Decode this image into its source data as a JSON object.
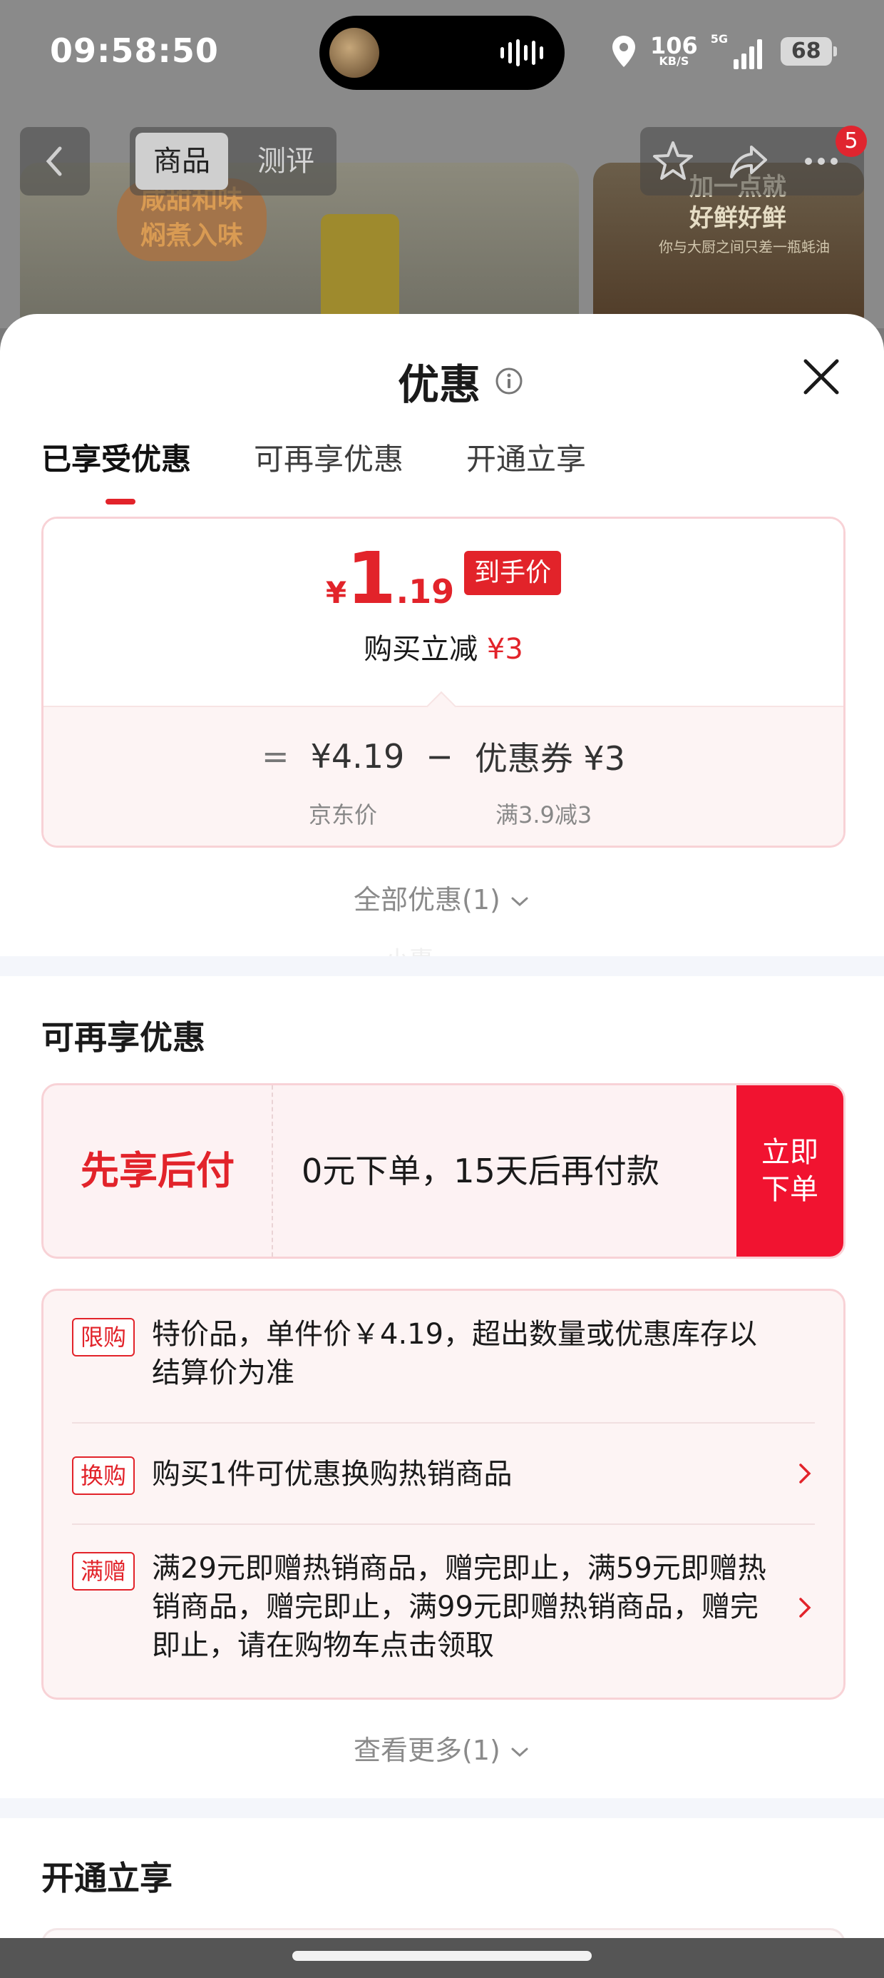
{
  "status_bar": {
    "time": "09:58:50",
    "net_speed": "106",
    "net_unit": "KB/S",
    "network": "5G",
    "battery": "68"
  },
  "background": {
    "tab_product": "商品",
    "tab_review": "测评",
    "cart_badge": "5",
    "banner_left": "咸甜和味\n焖煮入味",
    "banner_right": "加一点就\n好鲜好鲜",
    "banner_right_sub": "你与大厨之间只差一瓶蚝油"
  },
  "sheet": {
    "title": "优惠",
    "tabs": [
      "已享受优惠",
      "可再享优惠",
      "开通立享"
    ],
    "active_tab": 0,
    "final_price": {
      "symbol": "¥",
      "integer": "1",
      "decimal": ".19",
      "tag": "到手价"
    },
    "save_text": "购买立减",
    "save_amount": "¥3",
    "formula": {
      "equals": "=",
      "jd_price": "¥4.19",
      "minus": "−",
      "coupon": "优惠券 ¥3",
      "jd_price_label": "京东价",
      "coupon_label": "满3.9减3"
    },
    "all_offers_link": "全部优惠(1)",
    "watermark": "小惠",
    "more_section_title": "可再享优惠",
    "bnpl": {
      "title": "先享后付",
      "desc": "0元下单，15天后再付款",
      "button": "立即\n下单"
    },
    "promotions": [
      {
        "tag": "限购",
        "text": "特价品，单件价￥4.19，超出数量或优惠库存以结算价为准",
        "has_arrow": false
      },
      {
        "tag": "换购",
        "text": "购买1件可优惠换购热销商品",
        "has_arrow": true
      },
      {
        "tag": "满赠",
        "text": "满29元即赠热销商品，赠完即止，满59元即赠热销商品，赠完即止，满99元即赠热销商品，赠完即止，请在购物车点击领取",
        "has_arrow": true
      }
    ],
    "see_more_link": "查看更多(1)",
    "open_section_title": "开通立享"
  },
  "colors": {
    "accent": "#e2232a",
    "button_red": "#f11330",
    "card_border": "#f8d2d6",
    "card_bg": "#fdf4f4"
  }
}
